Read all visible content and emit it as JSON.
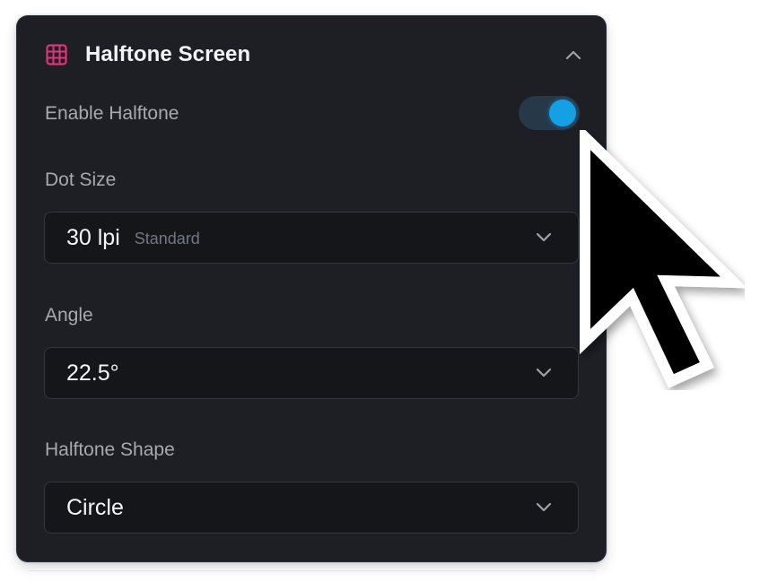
{
  "panel": {
    "title": "Halftone Screen",
    "header_icon": "grid-icon",
    "collapse_icon": "chevron-up-icon"
  },
  "enable_halftone": {
    "label": "Enable Halftone",
    "enabled": true
  },
  "dot_size": {
    "label": "Dot Size",
    "value": "30 lpi",
    "sublabel": "Standard"
  },
  "angle": {
    "label": "Angle",
    "value": "22.5°"
  },
  "shape": {
    "label": "Halftone Shape",
    "value": "Circle"
  },
  "colors": {
    "panel_bg": "#1d1f24",
    "accent": "#159fe5",
    "icon_pink": "#e0337a"
  }
}
